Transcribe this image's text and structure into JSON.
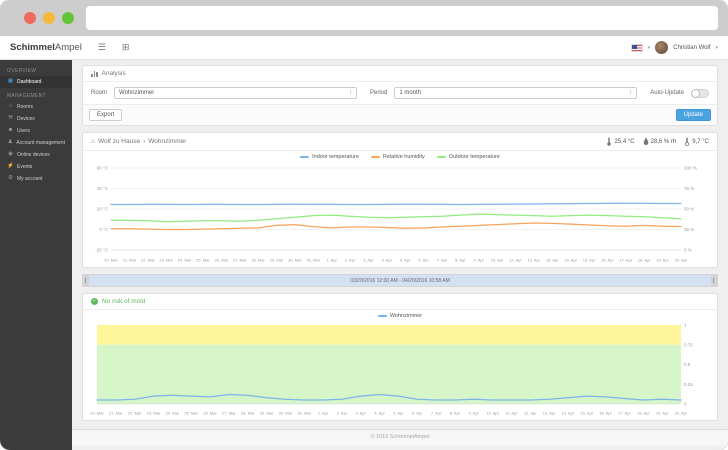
{
  "navbar": {
    "brand_bold": "Schimmel",
    "brand_light": "Ampel",
    "user_name": "Christian Wolf"
  },
  "sidebar": {
    "sections": [
      {
        "label": "OVERVIEW",
        "items": [
          {
            "label": "Dashboard",
            "icon": "dashboard-icon",
            "active": true
          }
        ]
      },
      {
        "label": "MANAGEMENT",
        "items": [
          {
            "label": "Rooms",
            "icon": "rooms-icon"
          },
          {
            "label": "Devices",
            "icon": "devices-icon"
          },
          {
            "label": "Users",
            "icon": "users-icon"
          },
          {
            "label": "Account management",
            "icon": "account-management-icon"
          },
          {
            "label": "Online devices",
            "icon": "online-devices-icon"
          },
          {
            "label": "Events",
            "icon": "events-icon"
          },
          {
            "label": "My account",
            "icon": "my-account-icon"
          }
        ]
      }
    ]
  },
  "analysis": {
    "title": "Analysis",
    "room_label": "Room",
    "room_value": "Wohnzimmer",
    "period_label": "Period",
    "period_value": "1 month",
    "auto_update_label": "Auto-Update",
    "auto_update_on": false,
    "export_label": "Export",
    "update_label": "Update"
  },
  "station": {
    "breadcrumb_home": "Wolf zu Hause",
    "breadcrumb_sep": "›",
    "breadcrumb_room": "Wohnzimmer",
    "indoor_temp": "25,4 °C",
    "humidity": "28,6 % rh",
    "outdoor_temp": "9,7 °C"
  },
  "navigator": {
    "range_label": "03/20/2016 12:00 AM - 04/20/2016 10:58 AM"
  },
  "mold": {
    "status": "No risk of mold"
  },
  "footer": {
    "copyright": "© 2015 SchimmelAmpel"
  },
  "colors": {
    "accent_blue": "#4aa3df",
    "indoor_series": "#7cb5ec",
    "humidity_series": "#f7a35c",
    "outdoor_series": "#90ed7d",
    "mold_ok_green": "#5cb85c",
    "warn_band_yellow": "#fff59b",
    "safe_band_green": "#d6f5c8"
  },
  "chart_data": [
    {
      "type": "line",
      "title": "",
      "categories": [
        "20. Mar",
        "21. Mar",
        "22. Mar",
        "23. Mar",
        "24. Mar",
        "25. Mar",
        "26. Mar",
        "27. Mar",
        "28. Mar",
        "29. Mar",
        "30. Mar",
        "31. Mar",
        "1. Apr",
        "2. Apr",
        "3. Apr",
        "4. Apr",
        "5. Apr",
        "6. Apr",
        "7. Apr",
        "8. Apr",
        "9. Apr",
        "10. Apr",
        "11. Apr",
        "12. Apr",
        "13. Apr",
        "14. Apr",
        "15. Apr",
        "16. Apr",
        "17. Apr",
        "18. Apr",
        "19. Apr",
        "20. Apr"
      ],
      "series": [
        {
          "name": "Indoor temperature",
          "color": "#7cb5ec",
          "axis": "temp",
          "values": [
            24.4,
            24.4,
            24.5,
            24.5,
            24.4,
            24.5,
            24.5,
            24.4,
            24.4,
            24.5,
            24.6,
            24.5,
            24.5,
            24.4,
            24.4,
            24.5,
            24.6,
            24.6,
            24.5,
            24.4,
            24.5,
            24.6,
            24.8,
            24.9,
            25.1,
            25.2,
            25.4,
            25.5,
            25.6,
            25.5,
            25.4,
            25.4
          ]
        },
        {
          "name": "Relative humidity",
          "color": "#f7a35c",
          "axis": "percent",
          "values": [
            26,
            26,
            25.5,
            25,
            25,
            25.5,
            26,
            26.5,
            27,
            30,
            31,
            28.5,
            27,
            28,
            28,
            27.5,
            26.5,
            27,
            28,
            29,
            30,
            31,
            32,
            33,
            32.5,
            31.5,
            30.5,
            29.5,
            29,
            30,
            29,
            28.6
          ]
        },
        {
          "name": "Outdoor temperature",
          "color": "#90ed7d",
          "axis": "temp",
          "values": [
            9,
            9,
            8.5,
            7.5,
            8,
            8.5,
            8.5,
            8,
            9,
            10.5,
            12,
            13.5,
            14,
            13,
            12,
            11.5,
            12,
            12.5,
            13,
            14,
            15,
            14.5,
            14,
            13.5,
            13,
            13.5,
            14,
            13.5,
            13,
            12.5,
            11.5,
            10.5
          ]
        }
      ],
      "y_left": {
        "ticks": [
          "60 °C",
          "40 °C",
          "20 °C",
          "0 °C",
          "-20 °C"
        ],
        "min": -20,
        "max": 60
      },
      "y_right": {
        "ticks": [
          "100 %",
          "75 %",
          "50 %",
          "25 %",
          "0 %"
        ],
        "min": 0,
        "max": 100
      },
      "legend_position": "top",
      "grid": true
    },
    {
      "type": "line",
      "title": "",
      "categories": [
        "20. Mar",
        "21. Mar",
        "22. Mar",
        "23. Mar",
        "24. Mar",
        "25. Mar",
        "26. Mar",
        "27. Mar",
        "28. Mar",
        "29. Mar",
        "30. Mar",
        "31. Mar",
        "1. Apr",
        "2. Apr",
        "3. Apr",
        "4. Apr",
        "5. Apr",
        "6. Apr",
        "7. Apr",
        "8. Apr",
        "9. Apr",
        "10. Apr",
        "11. Apr",
        "12. Apr",
        "13. Apr",
        "14. Apr",
        "15. Apr",
        "16. Apr",
        "17. Apr",
        "18. Apr",
        "19. Apr",
        "20. Apr"
      ],
      "series": [
        {
          "name": "Wohnzimmer",
          "color": "#7cb5ec",
          "axis": "index",
          "values": [
            0.05,
            0.05,
            0.06,
            0.1,
            0.11,
            0.1,
            0.09,
            0.12,
            0.11,
            0.08,
            0.06,
            0.05,
            0.05,
            0.06,
            0.1,
            0.12,
            0.1,
            0.06,
            0.05,
            0.05,
            0.06,
            0.05,
            0.05,
            0.05,
            0.06,
            0.08,
            0.1,
            0.09,
            0.07,
            0.05,
            0.06,
            0.05
          ]
        }
      ],
      "y_right": {
        "ticks": [
          "1",
          "0.75",
          "0.5",
          "0.25",
          "0"
        ],
        "min": 0,
        "max": 1
      },
      "bands": [
        {
          "from": 0.75,
          "to": 1,
          "color": "#fff59b"
        },
        {
          "from": 0,
          "to": 0.75,
          "color": "#d6f5c8"
        }
      ],
      "legend_position": "top",
      "grid": false
    }
  ]
}
